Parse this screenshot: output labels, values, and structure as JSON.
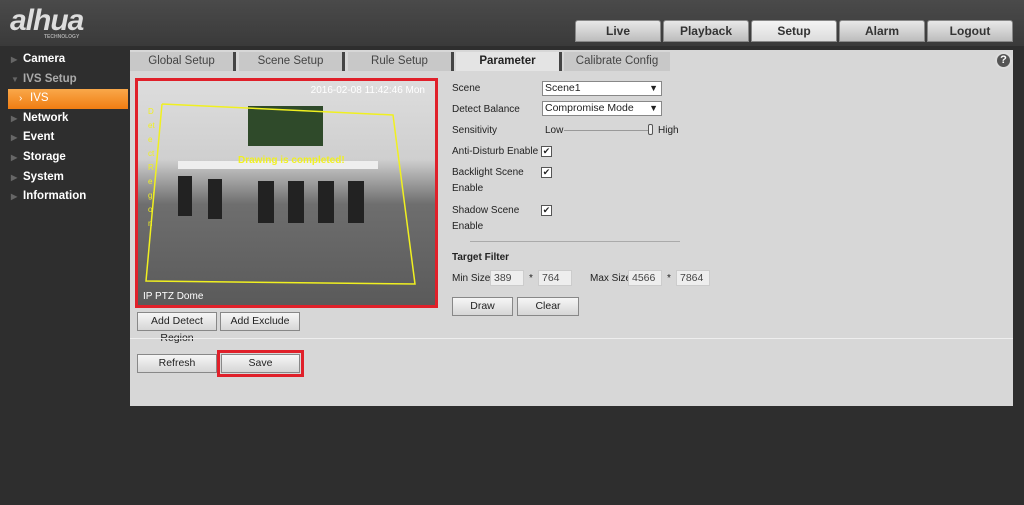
{
  "header": {
    "logo": "alhua",
    "logo_sub": "TECHNOLOGY",
    "nav": [
      "Live",
      "Playback",
      "Setup",
      "Alarm",
      "Logout"
    ],
    "active": "Setup"
  },
  "sidebar": {
    "items": [
      {
        "label": "Camera"
      },
      {
        "label": "IVS Setup"
      },
      {
        "label": "IVS"
      },
      {
        "label": "Network"
      },
      {
        "label": "Event"
      },
      {
        "label": "Storage"
      },
      {
        "label": "System"
      },
      {
        "label": "Information"
      }
    ]
  },
  "tabs": [
    "Global Setup",
    "Scene Setup",
    "Rule Setup",
    "Parameter",
    "Calibrate Config"
  ],
  "help": "?",
  "video": {
    "timestamp": "2016-02-08 11:42:46 Mon",
    "overlay": "Drawing is completed!",
    "region_label": "Detect Region",
    "camera_name": "IP PTZ Dome"
  },
  "buttons": {
    "add_detect": "Add Detect Region",
    "add_exclude": "Add Exclude",
    "draw": "Draw",
    "clear": "Clear",
    "refresh": "Refresh",
    "save": "Save"
  },
  "params": {
    "scene_label": "Scene",
    "scene_value": "Scene1",
    "balance_label": "Detect Balance",
    "balance_value": "Compromise Mode",
    "sensitivity_label": "Sensitivity",
    "low": "Low",
    "high": "High",
    "sensitivity_value": 1.0,
    "anti_disturb": "Anti-Disturb Enable",
    "backlight": "Backlight Scene",
    "backlight2": "Enable",
    "shadow": "Shadow Scene",
    "shadow2": "Enable",
    "check": "✔",
    "target_filter": "Target Filter",
    "min_size": "Min Size",
    "min_w": "389",
    "min_h": "764",
    "max_size": "Max Size",
    "max_w": "4566",
    "max_h": "7864",
    "times": "*"
  }
}
